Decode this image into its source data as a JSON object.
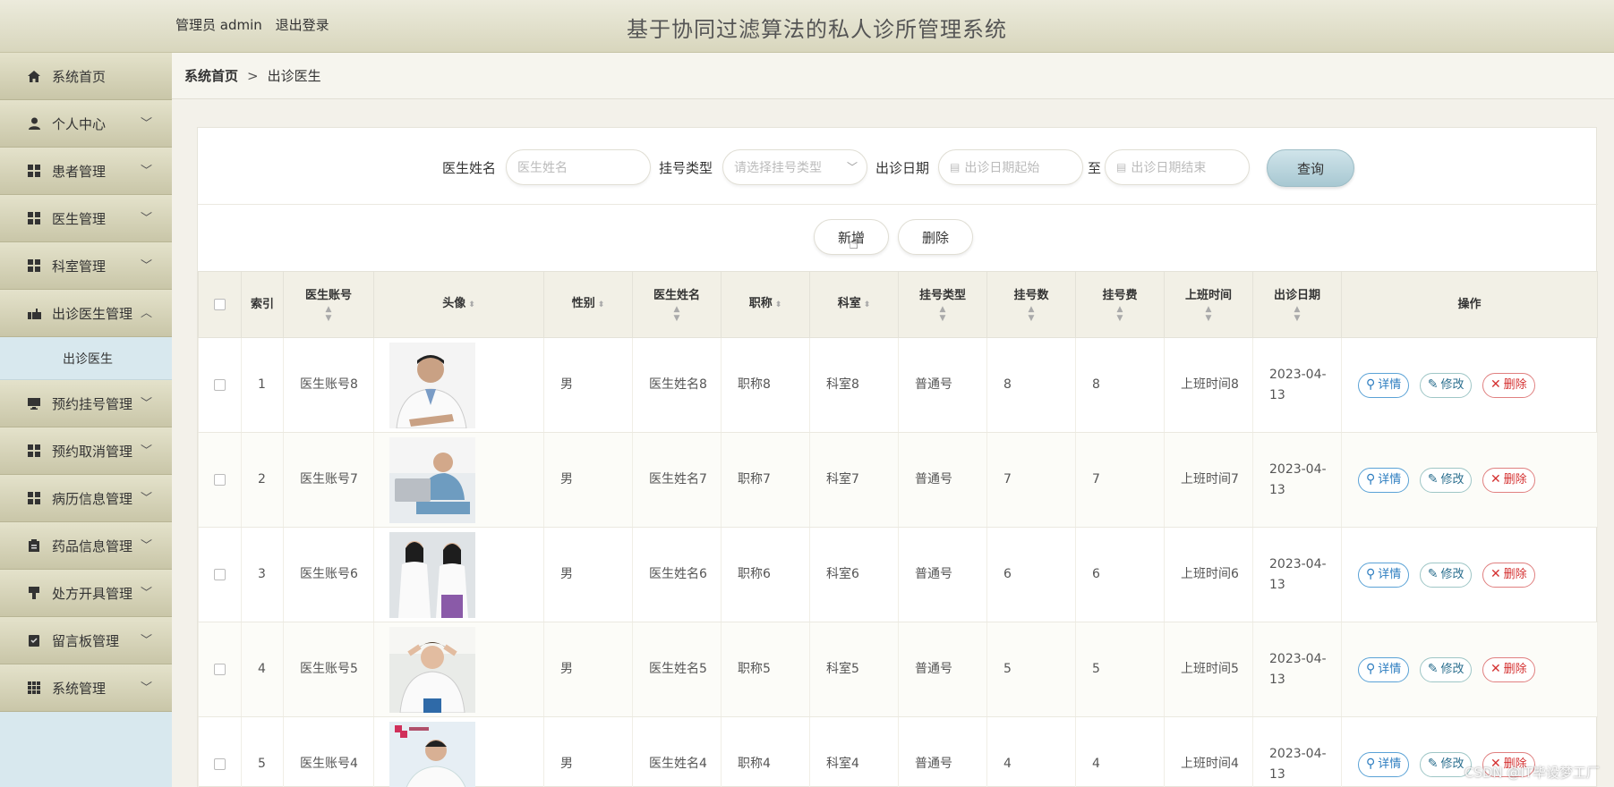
{
  "header": {
    "user_label": "管理员 admin",
    "logout": "退出登录",
    "title": "基于协同过滤算法的私人诊所管理系统"
  },
  "sidebar": {
    "items": [
      {
        "label": "系统首页",
        "icon": "home-icon"
      },
      {
        "label": "个人中心",
        "icon": "user-icon"
      },
      {
        "label": "患者管理",
        "icon": "grid-icon"
      },
      {
        "label": "医生管理",
        "icon": "grid-icon"
      },
      {
        "label": "科室管理",
        "icon": "grid-icon"
      },
      {
        "label": "出诊医生管理",
        "icon": "hand-icon",
        "expanded": true
      },
      {
        "label": "预约挂号管理",
        "icon": "monitor-icon"
      },
      {
        "label": "预约取消管理",
        "icon": "grid-icon"
      },
      {
        "label": "病历信息管理",
        "icon": "grid-icon"
      },
      {
        "label": "药品信息管理",
        "icon": "clipboard-icon"
      },
      {
        "label": "处方开具管理",
        "icon": "stamp-icon"
      },
      {
        "label": "留言板管理",
        "icon": "notes-icon"
      },
      {
        "label": "系统管理",
        "icon": "grid9-icon"
      }
    ],
    "subitem": "出诊医生"
  },
  "breadcrumb": {
    "home": "系统首页",
    "separator": ">",
    "current": "出诊医生"
  },
  "search": {
    "doctor_name_label": "医生姓名",
    "doctor_name_placeholder": "医生姓名",
    "reg_type_label": "挂号类型",
    "reg_type_placeholder": "请选择挂号类型",
    "date_label": "出诊日期",
    "date_start_placeholder": "出诊日期起始",
    "to": "至",
    "date_end_placeholder": "出诊日期结束",
    "query": "查询"
  },
  "actions": {
    "add": "新增",
    "delete": "删除"
  },
  "table": {
    "headers": {
      "index": "索引",
      "account": "医生账号",
      "avatar": "头像",
      "gender": "性别",
      "name": "医生姓名",
      "title": "职称",
      "dept": "科室",
      "reg_type": "挂号类型",
      "reg_count": "挂号数",
      "reg_fee": "挂号费",
      "work_time": "上班时间",
      "visit_date": "出诊日期",
      "ops": "操作"
    },
    "rows": [
      {
        "index": "1",
        "account": "医生账号8",
        "gender": "男",
        "name": "医生姓名8",
        "title": "职称8",
        "dept": "科室8",
        "reg_type": "普通号",
        "reg_count": "8",
        "reg_fee": "8",
        "work_time": "上班时间8",
        "visit_date": "2023-04-13"
      },
      {
        "index": "2",
        "account": "医生账号7",
        "gender": "男",
        "name": "医生姓名7",
        "title": "职称7",
        "dept": "科室7",
        "reg_type": "普通号",
        "reg_count": "7",
        "reg_fee": "7",
        "work_time": "上班时间7",
        "visit_date": "2023-04-13"
      },
      {
        "index": "3",
        "account": "医生账号6",
        "gender": "男",
        "name": "医生姓名6",
        "title": "职称6",
        "dept": "科室6",
        "reg_type": "普通号",
        "reg_count": "6",
        "reg_fee": "6",
        "work_time": "上班时间6",
        "visit_date": "2023-04-13"
      },
      {
        "index": "4",
        "account": "医生账号5",
        "gender": "男",
        "name": "医生姓名5",
        "title": "职称5",
        "dept": "科室5",
        "reg_type": "普通号",
        "reg_count": "5",
        "reg_fee": "5",
        "work_time": "上班时间5",
        "visit_date": "2023-04-13"
      },
      {
        "index": "5",
        "account": "医生账号4",
        "gender": "男",
        "name": "医生姓名4",
        "title": "职称4",
        "dept": "科室4",
        "reg_type": "普通号",
        "reg_count": "4",
        "reg_fee": "4",
        "work_time": "上班时间4",
        "visit_date": "2023-04-13"
      }
    ],
    "row_buttons": {
      "detail": "详情",
      "edit": "修改",
      "delete": "删除"
    }
  },
  "watermark": "CSDN @IT毕设梦工厂",
  "colors": {
    "header_bg": "#dedcc6",
    "sidebar_item_bg": "#d3d1b6",
    "accent": "#a8c8d2",
    "delete_red": "#d43030",
    "detail_blue": "#2d7dc0"
  }
}
